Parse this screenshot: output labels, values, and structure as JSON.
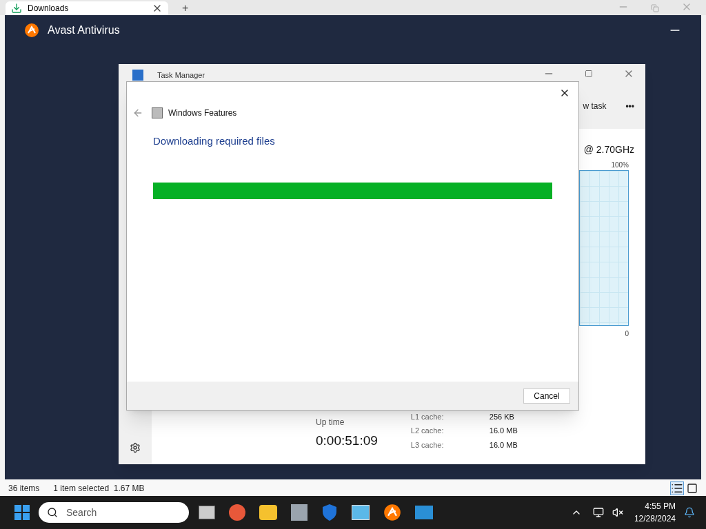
{
  "browser_tab": {
    "title": "Downloads",
    "new_tab": "+"
  },
  "avast": {
    "title": "Avast Antivirus"
  },
  "task_manager": {
    "title": "Task Manager",
    "toolbar_action": "w task",
    "more": "•••",
    "cpu_speed": "@ 2.70GHz",
    "graph_max": "100%",
    "graph_min": "0",
    "uptime_label": "Up time",
    "uptime": "0:00:51:09",
    "caches": [
      {
        "label": "L1 cache:",
        "value": "256 KB"
      },
      {
        "label": "L2 cache:",
        "value": "16.0 MB"
      },
      {
        "label": "L3 cache:",
        "value": "16.0 MB"
      }
    ]
  },
  "dialog": {
    "title": "Windows Features",
    "heading": "Downloading required files",
    "progress": {
      "level": 1
    },
    "buttons": [
      "Cancel"
    ]
  },
  "status_bar": {
    "count": "36 items",
    "selection": "1 item selected  1.67 MB"
  },
  "taskbar": {
    "search_placeholder": "Search",
    "time": "4:55 PM",
    "date": "12/28/2024"
  }
}
